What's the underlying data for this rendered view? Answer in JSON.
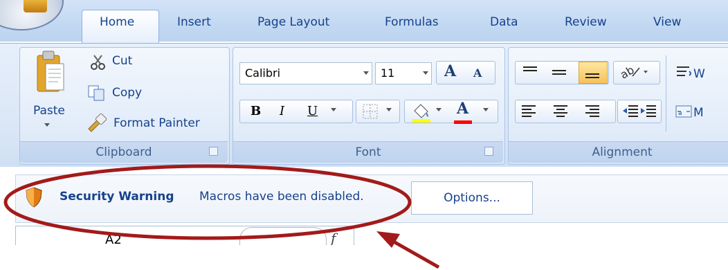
{
  "ribbon": {
    "tabs": [
      {
        "label": "Home",
        "active": true
      },
      {
        "label": "Insert"
      },
      {
        "label": "Page Layout"
      },
      {
        "label": "Formulas"
      },
      {
        "label": "Data"
      },
      {
        "label": "Review"
      },
      {
        "label": "View"
      }
    ],
    "clipboard": {
      "group_label": "Clipboard",
      "paste_label": "Paste",
      "cut_label": "Cut",
      "copy_label": "Copy",
      "format_painter_label": "Format Painter"
    },
    "font": {
      "group_label": "Font",
      "font_name": "Calibri",
      "font_size": "11",
      "bold": "B",
      "italic": "I",
      "underline": "U",
      "grow_font": "A",
      "shrink_font": "A",
      "font_color_glyph": "A",
      "fill_color": "#ffff00",
      "font_color": "#ff0000"
    },
    "alignment": {
      "group_label": "Alignment"
    }
  },
  "message_bar": {
    "title": "Security Warning",
    "text": "Macros have been disabled.",
    "options_label": "Options..."
  },
  "formula_bar": {
    "name_box": "A2",
    "fx": "f"
  },
  "annotation": {
    "circle_color": "#a31a1a",
    "arrow_color": "#a31a1a"
  }
}
